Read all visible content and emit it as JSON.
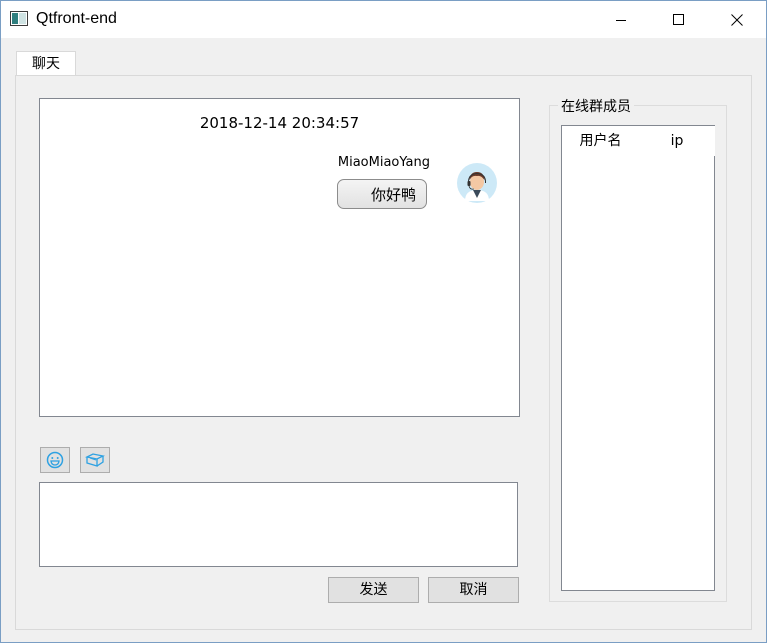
{
  "window": {
    "title": "Qtfront-end"
  },
  "tabs": [
    {
      "label": "聊天"
    }
  ],
  "chat": {
    "timestamp": "2018-12-14 20:34:57",
    "messages": [
      {
        "sender": "MiaoMiaoYang",
        "text": "你好鸭",
        "avatar": "user-avatar"
      }
    ]
  },
  "toolbar": {
    "emoji_icon": "smiley-icon",
    "screenshot_icon": "box-icon"
  },
  "input": {
    "value": ""
  },
  "buttons": {
    "send": "发送",
    "cancel": "取消"
  },
  "members": {
    "group_title": "在线群成员",
    "columns": [
      "用户名",
      "ip"
    ],
    "rows": []
  },
  "colors": {
    "icon_blue": "#2ea1e2",
    "border": "#828790"
  }
}
